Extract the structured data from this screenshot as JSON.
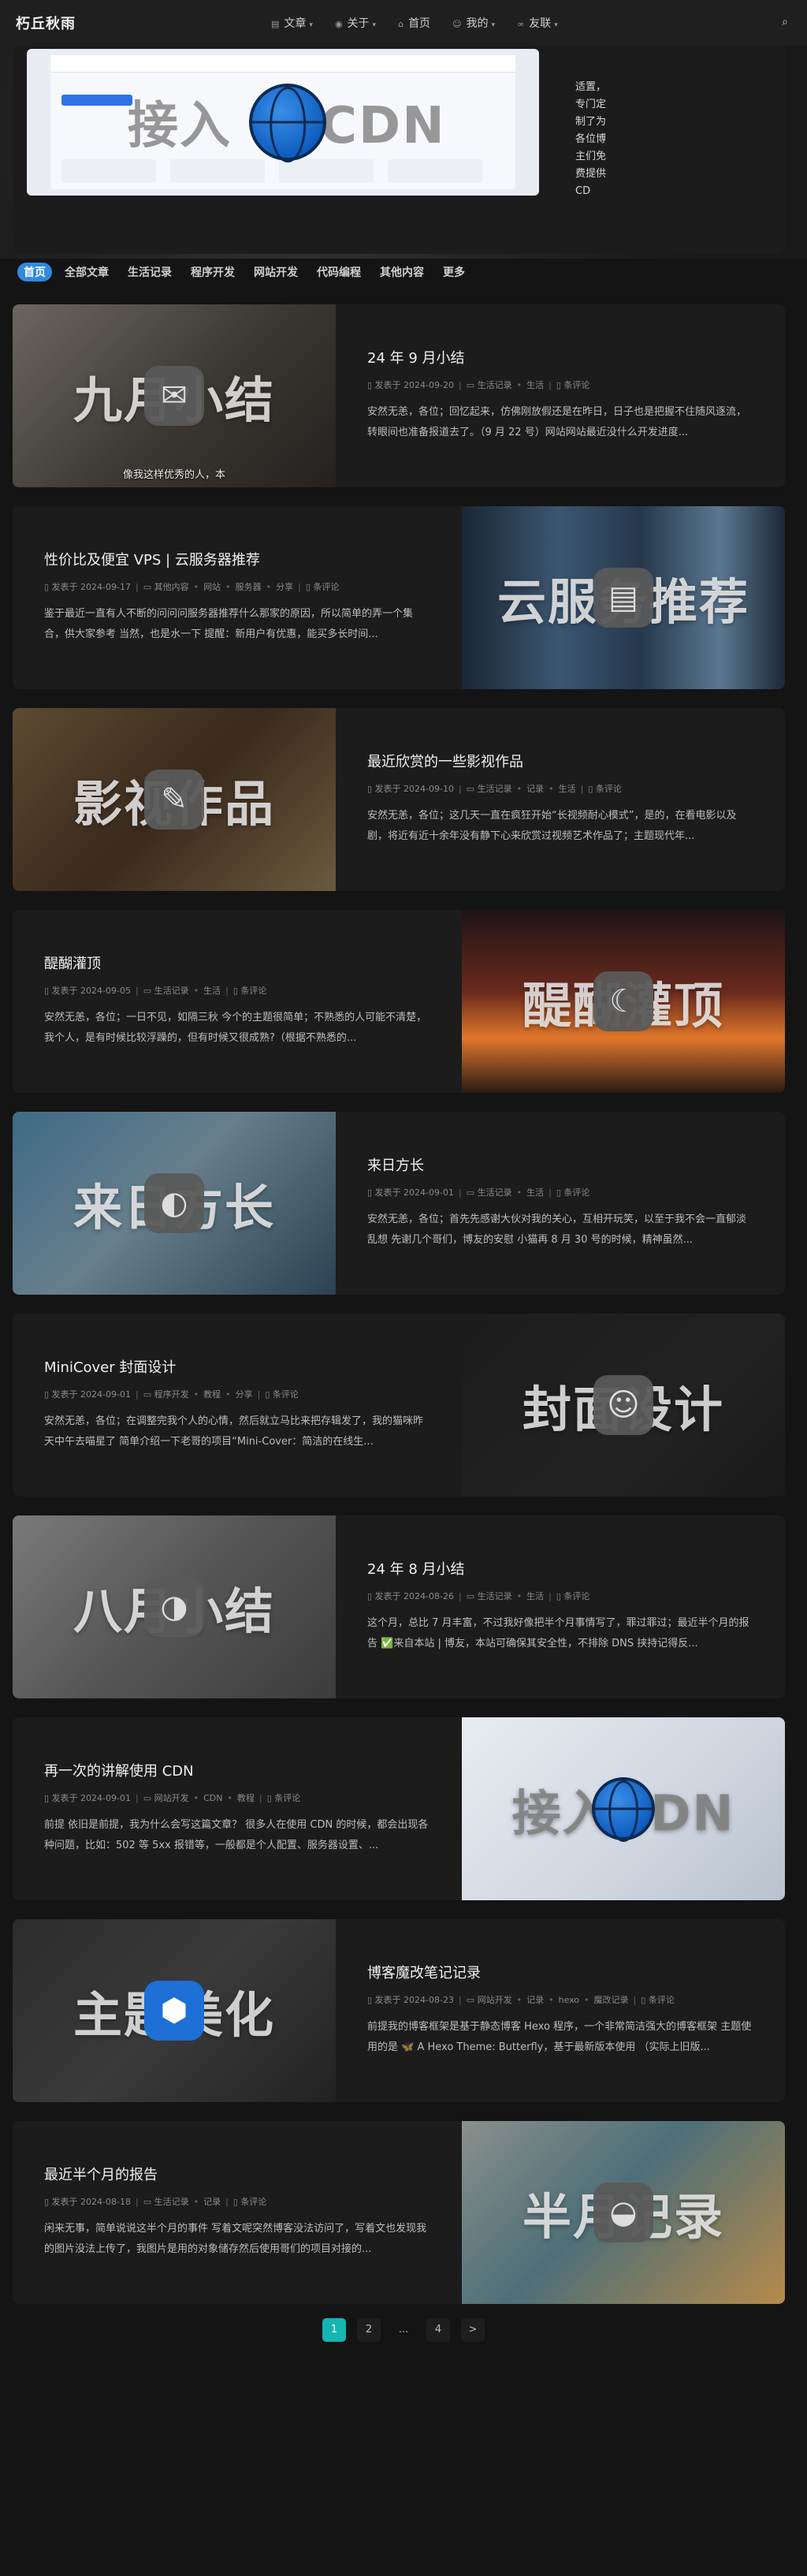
{
  "nav": {
    "brand": "朽丘秋雨",
    "items": [
      {
        "label": "文章",
        "caret": true
      },
      {
        "label": "关于",
        "caret": true
      },
      {
        "label": "首页",
        "caret": false
      },
      {
        "label": "我的",
        "caret": true
      },
      {
        "label": "友联",
        "caret": true
      }
    ]
  },
  "hero": {
    "image_title": "接入",
    "image_title2": "CDN",
    "side_text": "适置，专门定制了为各位博主们免费提供CD"
  },
  "categories": [
    "首页",
    "全部文章",
    "生活记录",
    "程序开发",
    "网站开发",
    "代码编程",
    "其他内容",
    "更多"
  ],
  "posts": [
    {
      "title": "24 年 9 月小结",
      "date": "发表于 2024-09-20",
      "tags": [
        "生活记录",
        "生活"
      ],
      "comments": "条评论",
      "excerpt": "安然无恙，各位；回忆起来，仿佛刚放假还是在昨日，日子也是把握不住随风逐流，转眼间也准备报道去了。（9 月 22 号）网站网站最近没什么开发进度...",
      "thumb_text": "九月小结",
      "caption": "像我这样优秀的人，本"
    },
    {
      "title": "性价比及便宜 VPS | 云服务器推荐",
      "date": "发表于 2024-09-17",
      "tags": [
        "其他内容",
        "网站",
        "服务器",
        "分享"
      ],
      "comments": "条评论",
      "excerpt": "鉴于最近一直有人不断的问问问服务器推荐什么那家的原因，所以简单的弄一个集合，供大家参考 当然，也是水一下 提醒：新用户有优惠，能买多长时间...",
      "thumb_text": "云服务推荐",
      "caption": ""
    },
    {
      "title": "最近欣赏的一些影视作品",
      "date": "发表于 2024-09-10",
      "tags": [
        "生活记录",
        "记录",
        "生活"
      ],
      "comments": "条评论",
      "excerpt": "安然无恙，各位；这几天一直在疯狂开始“长视频耐心模式”，是的，在看电影以及剧，将近有近十余年没有静下心来欣赏过视频艺术作品了；主题现代年...",
      "thumb_text": "影视作品",
      "caption": ""
    },
    {
      "title": "醍醐灌顶",
      "date": "发表于 2024-09-05",
      "tags": [
        "生活记录",
        "生活"
      ],
      "comments": "条评论",
      "excerpt": "安然无恙，各位；一日不见，如隔三秋 今个的主题很简单；不熟悉的人可能不清楚，我个人，是有时候比较浮躁的，但有时候又很成熟?（根据不熟悉的...",
      "thumb_text": "醍醐灌顶",
      "caption": ""
    },
    {
      "title": "来日方长",
      "date": "发表于 2024-09-01",
      "tags": [
        "生活记录",
        "生活"
      ],
      "comments": "条评论",
      "excerpt": "安然无恙，各位；首先先感谢大伙对我的关心，互相开玩笑，以至于我不会一直郁淡乱想 先谢几个哥们，博友的安慰 小猫再 8 月 30 号的时候，精神虽然...",
      "thumb_text": "来日方长",
      "caption": ""
    },
    {
      "title": "MiniCover 封面设计",
      "date": "发表于 2024-09-01",
      "tags": [
        "程序开发",
        "教程",
        "分享"
      ],
      "comments": "条评论",
      "excerpt": "安然无恙，各位；在调整完我个人的心情，然后就立马比来把存辑发了，我的猫咪昨天中午去喵星了 简单介绍一下老哥的项目“Mini-Cover：简洁的在线生...",
      "thumb_text": "封面设计",
      "caption": ""
    },
    {
      "title": "24 年 8 月小结",
      "date": "发表于 2024-08-26",
      "tags": [
        "生活记录",
        "生活"
      ],
      "comments": "条评论",
      "excerpt": "这个月，总比 7 月丰富，不过我好像把半个月事情写了，罪过罪过；最近半个月的报告 ✅来自本站 | 博友，本站可确保其安全性，不排除 DNS 挟持记得反...",
      "thumb_text": "八月小结",
      "caption": ""
    },
    {
      "title": "再一次的讲解使用 CDN",
      "date": "发表于 2024-09-01",
      "tags": [
        "网站开发",
        "CDN",
        "教程"
      ],
      "comments": "条评论",
      "excerpt": "前提 依旧是前提，我为什么会写这篇文章？ 很多人在使用 CDN 的时候，都会出现各种问题，比如：502 等 5xx 报错等，一般都是个人配置、服务器设置、...",
      "thumb_text": "接入CDN",
      "caption": ""
    },
    {
      "title": "博客魔改笔记记录",
      "date": "发表于 2024-08-23",
      "tags": [
        "网站开发",
        "记录",
        "hexo",
        "魔改记录"
      ],
      "comments": "条评论",
      "excerpt": "前提我的博客框架是基于静态博客 Hexo 程序，一个非常简洁强大的博客框架 主题使用的是 🦋 A Hexo Theme: Butterfly，基于最新版本使用 （实际上旧版...",
      "thumb_text": "主题美化",
      "caption": ""
    },
    {
      "title": "最近半个月的报告",
      "date": "发表于 2024-08-18",
      "tags": [
        "生活记录",
        "记录"
      ],
      "comments": "条评论",
      "excerpt": "闲来无事，简单说说这半个月的事件 写着文呢突然博客没法访问了，写着文也发现我的图片没法上传了，我图片是用的对象储存然后使用哥们的项目对接的...",
      "thumb_text": "半月记录",
      "caption": ""
    }
  ],
  "pager": [
    "1",
    "2",
    "...",
    "4",
    ">"
  ],
  "colors": {
    "accent": "#2f89e0",
    "page_current": "#16b5b2",
    "background": "#141414",
    "card": "#1c1c1c"
  }
}
